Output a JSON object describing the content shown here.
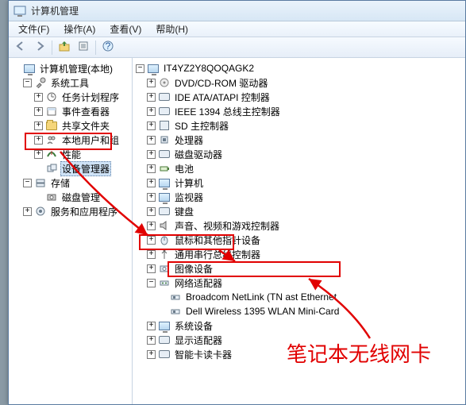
{
  "window": {
    "title": "计算机管理"
  },
  "menu": {
    "file": "文件(F)",
    "action": "操作(A)",
    "view": "查看(V)",
    "help": "帮助(H)"
  },
  "toolbar": {
    "back": "←",
    "forward": "→",
    "up": "⇧",
    "props": "☰",
    "help": "?",
    "refresh": "⟳"
  },
  "left_tree": {
    "root": "计算机管理(本地)",
    "sys_tools": "系统工具",
    "task_sched": "任务计划程序",
    "event_viewer": "事件查看器",
    "shared_folders": "共享文件夹",
    "local_users": "本地用户和组",
    "perf": "性能",
    "dev_mgr": "设备管理器",
    "storage": "存储",
    "disk_mgmt": "磁盘管理",
    "services": "服务和应用程序"
  },
  "right_tree": {
    "root": "IT4YZ2Y8QOQAGK2",
    "items": {
      "dvd": "DVD/CD-ROM 驱动器",
      "ide": "IDE ATA/ATAPI 控制器",
      "ieee": "IEEE 1394 总线主控制器",
      "sd": "SD 主控制器",
      "cpu": "处理器",
      "disk": "磁盘驱动器",
      "battery": "电池",
      "computer": "计算机",
      "monitor": "监视器",
      "keyboard": "键盘",
      "sound": "声音、视频和游戏控制器",
      "mouse": "鼠标和其他指针设备",
      "usb": "通用串行总线控制器",
      "imaging": "图像设备",
      "network": "网络适配器",
      "net_broadcom": "Broadcom NetLink (TN ast Ethernet",
      "net_dell": "Dell Wireless 1395 WLAN Mini-Card",
      "sysdev": "系统设备",
      "display": "显示适配器",
      "smartcard": "智能卡读卡器"
    }
  },
  "annotation": {
    "label": "笔记本无线网卡"
  }
}
